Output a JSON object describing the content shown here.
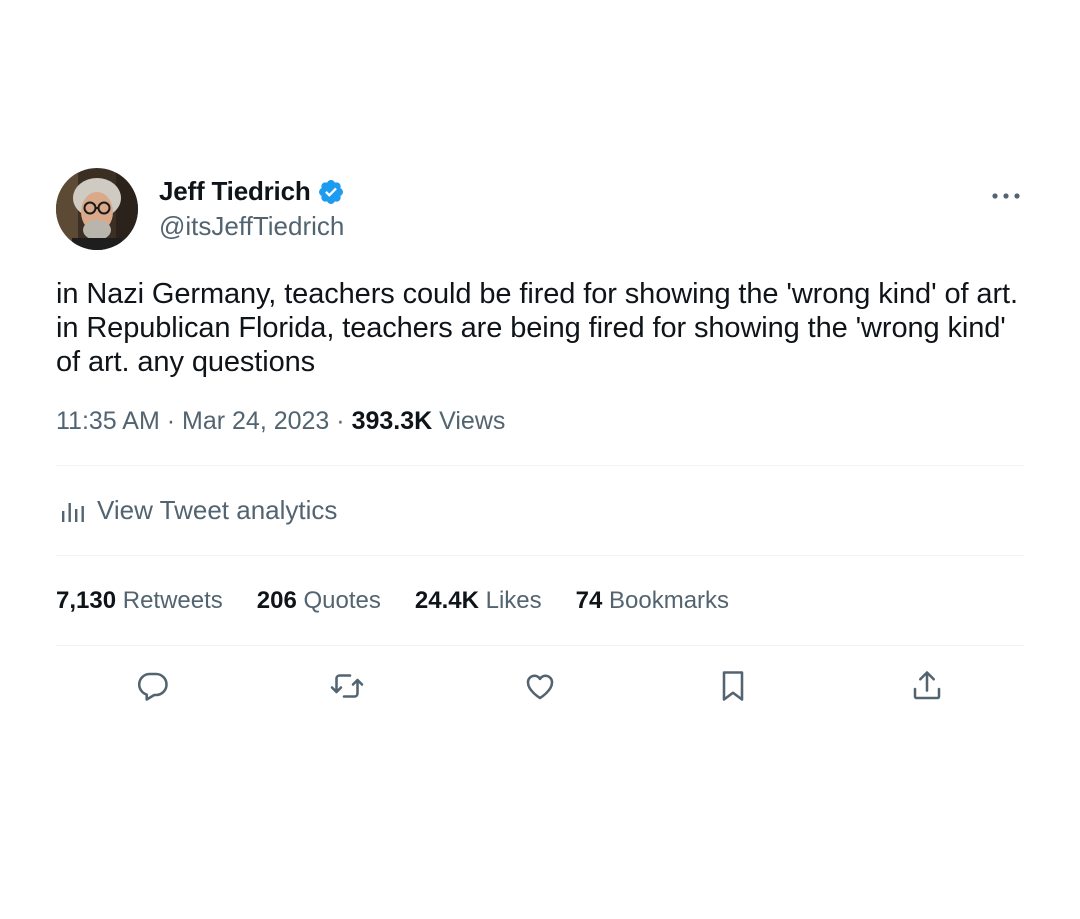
{
  "tweet": {
    "author": {
      "display_name": "Jeff Tiedrich",
      "handle": "@itsJeffTiedrich",
      "verified": true,
      "verified_color": "#1d9bf0"
    },
    "more_icon": "more-horizontal-icon",
    "text": "in Nazi Germany, teachers could be fired for showing the 'wrong kind' of art. in Republican Florida, teachers are being fired for showing the 'wrong kind' of art. any questions",
    "time": "11:35 AM",
    "separator": "·",
    "date": "Mar 24, 2023",
    "views_count": "393.3K",
    "views_label": "Views",
    "analytics_label": "View Tweet analytics",
    "stats": {
      "retweets_count": "7,130",
      "retweets_label": "Retweets",
      "quotes_count": "206",
      "quotes_label": "Quotes",
      "likes_count": "24.4K",
      "likes_label": "Likes",
      "bookmarks_count": "74",
      "bookmarks_label": "Bookmarks"
    },
    "actions": [
      "reply-icon",
      "retweet-icon",
      "like-icon",
      "bookmark-icon",
      "share-icon"
    ]
  },
  "colors": {
    "text_primary": "#0f1419",
    "text_secondary": "#536471",
    "divider": "#eff3f4",
    "accent": "#1d9bf0"
  }
}
